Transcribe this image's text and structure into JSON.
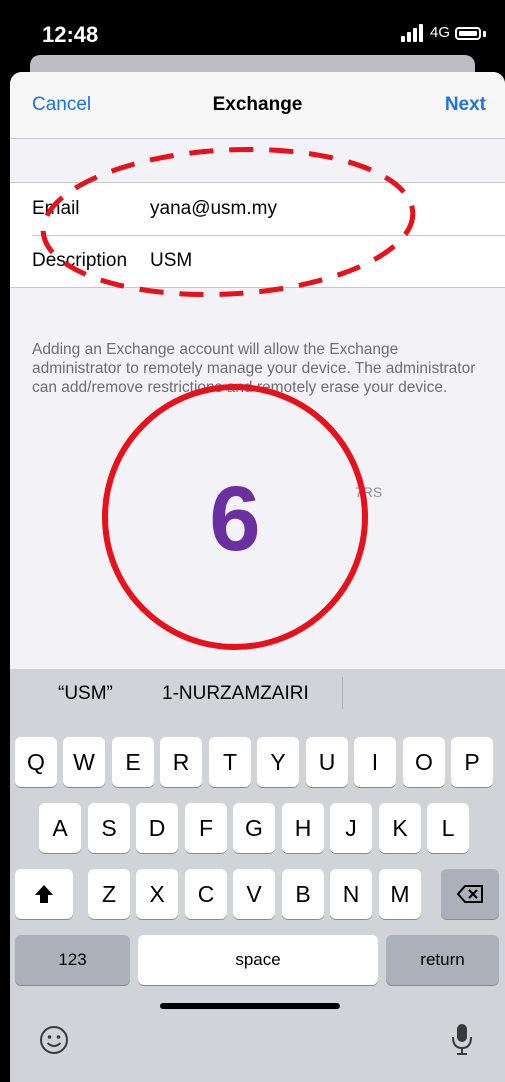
{
  "status": {
    "time": "12:48",
    "network": "4G"
  },
  "nav": {
    "cancel": "Cancel",
    "title": "Exchange",
    "next": "Next"
  },
  "form": [
    {
      "label": "Email",
      "value": "yana@usm.my"
    },
    {
      "label": "Description",
      "value": "USM"
    }
  ],
  "note": "Adding an Exchange account will allow the Exchange administrator to remotely manage your device. The administrator can add/remove restrictions and remotely erase your device.",
  "partial_text": "7RS",
  "annotation": {
    "number": "6",
    "number_color": "#6a2fa0",
    "ring_color": "#e8101a"
  },
  "predictions": [
    "“USM”",
    "1-NURZAMZAIRI"
  ],
  "keyboard": {
    "row1": [
      "Q",
      "W",
      "E",
      "R",
      "T",
      "Y",
      "U",
      "I",
      "O",
      "P"
    ],
    "row2": [
      "A",
      "S",
      "D",
      "F",
      "G",
      "H",
      "J",
      "K",
      "L"
    ],
    "row3": [
      "Z",
      "X",
      "C",
      "V",
      "B",
      "N",
      "M"
    ],
    "numbers": "123",
    "space": "space",
    "return": "return"
  }
}
